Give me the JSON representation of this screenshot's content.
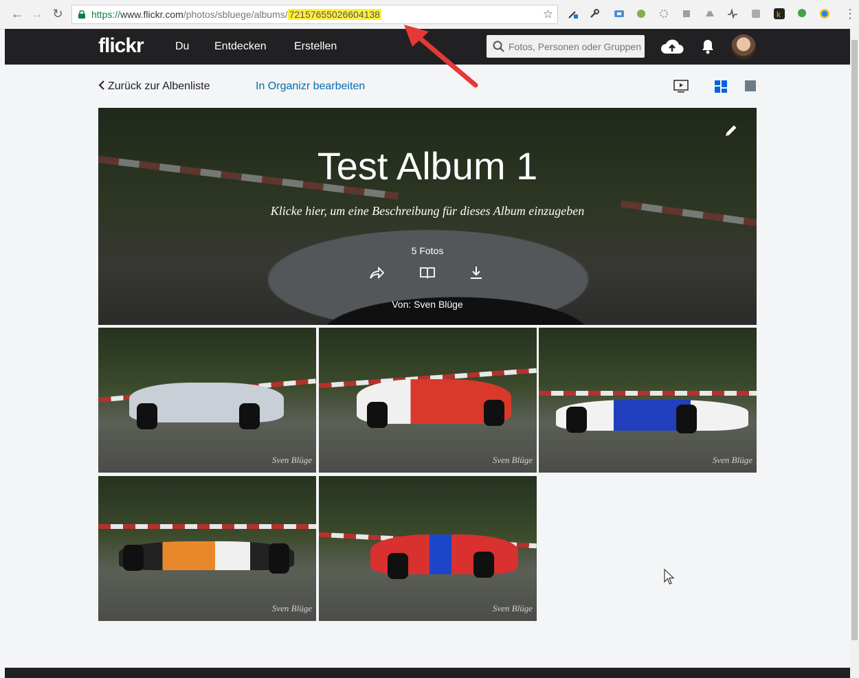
{
  "browser": {
    "back": "←",
    "forward": "→",
    "reload": "↻",
    "url_proto": "https://",
    "url_host": "www.flickr.com",
    "url_path": "/photos/sbluege/albums/",
    "url_id": "72157655026604138",
    "star": "☆",
    "menu": "⋮"
  },
  "header": {
    "logo": "flickr",
    "nav": [
      "Du",
      "Entdecken",
      "Erstellen"
    ],
    "search_placeholder": "Fotos, Personen oder Gruppen"
  },
  "toolbar": {
    "back_label": "Zurück zur Albenliste",
    "organizr_label": "In Organizr bearbeiten"
  },
  "album": {
    "title": "Test Album 1",
    "description": "Klicke hier, um eine Beschreibung für dieses Album einzugeben",
    "count": "5 Fotos",
    "owner": "Von: Sven Blüge"
  },
  "photos": [
    {
      "signature": "Sven Blüge"
    },
    {
      "signature": "Sven Blüge"
    },
    {
      "signature": "Sven Blüge"
    },
    {
      "signature": "Sven Blüge"
    },
    {
      "signature": "Sven Blüge"
    }
  ],
  "colors": {
    "header_bg": "#212124",
    "link_blue": "#006dac",
    "url_highlight": "#ffef3b",
    "annotation_arrow": "#e53935",
    "view_active": "#0063dc"
  }
}
